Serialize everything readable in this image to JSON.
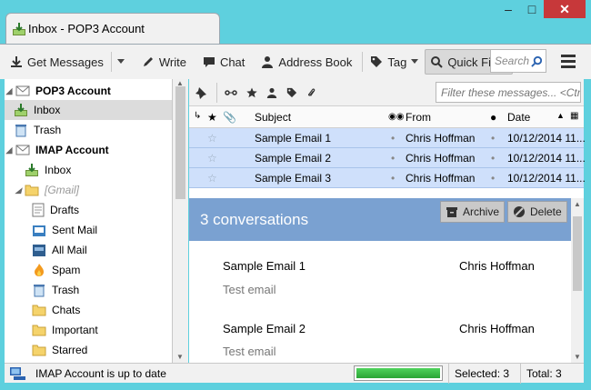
{
  "tab": {
    "title": "Inbox - POP3 Account"
  },
  "toolbar": {
    "get_messages": "Get Messages",
    "write": "Write",
    "chat": "Chat",
    "address_book": "Address Book",
    "tag": "Tag",
    "quick_filter": "Quick Filter",
    "search_placeholder": "Search"
  },
  "folders": {
    "pop3_account": "POP3 Account",
    "inbox": "Inbox",
    "trash": "Trash",
    "imap_account": "IMAP Account",
    "imap_inbox": "Inbox",
    "gmail": "[Gmail]",
    "drafts": "Drafts",
    "sent_mail": "Sent Mail",
    "all_mail": "All Mail",
    "spam": "Spam",
    "imap_trash": "Trash",
    "chats": "Chats",
    "important": "Important",
    "starred": "Starred"
  },
  "quick_filter": {
    "search_placeholder": "Filter these messages... <Ctrl+Shift+K>"
  },
  "columns": {
    "subject": "Subject",
    "from": "From",
    "date": "Date"
  },
  "messages": [
    {
      "subject": "Sample Email 1",
      "from": "Chris Hoffman",
      "date": "10/12/2014 11..."
    },
    {
      "subject": "Sample Email 2",
      "from": "Chris Hoffman",
      "date": "10/12/2014 11..."
    },
    {
      "subject": "Sample Email 3",
      "from": "Chris Hoffman",
      "date": "10/12/2014 11..."
    }
  ],
  "conversation": {
    "title": "3 conversations",
    "archive": "Archive",
    "delete": "Delete",
    "items": [
      {
        "subject": "Sample Email 1",
        "from": "Chris Hoffman",
        "snippet": "Test email"
      },
      {
        "subject": "Sample Email 2",
        "from": "Chris Hoffman",
        "snippet": "Test email"
      }
    ]
  },
  "status": {
    "text": "IMAP Account is up to date",
    "progress_fraction": 1.0,
    "selected": "Selected: 3",
    "total": "Total: 3"
  }
}
